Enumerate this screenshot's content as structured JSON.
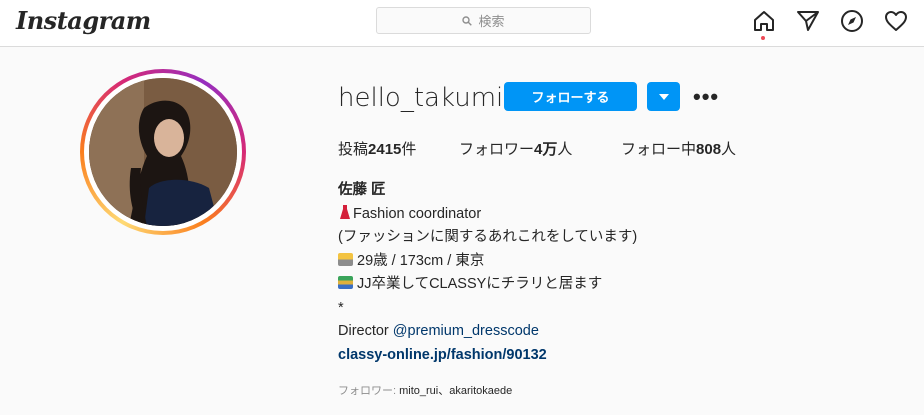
{
  "header": {
    "logo": "Instagram",
    "search_placeholder": "検索",
    "icons": [
      "home-icon",
      "direct-icon",
      "explore-icon",
      "activity-icon"
    ]
  },
  "profile": {
    "username": "hello_takumi",
    "follow_label": "フォローする",
    "stats": {
      "posts_label": "投稿",
      "posts_value": "2415",
      "posts_unit": "件",
      "followers_label": "フォロワー",
      "followers_value": "4万",
      "followers_unit": "人",
      "following_label": "フォロー中",
      "following_value": "808",
      "following_unit": "人"
    },
    "bio": {
      "name": "佐藤 匠",
      "line1": "Fashion coordinator",
      "line2": "(ファッションに関するあれこれをしています)",
      "line3": "29歳 / 173cm / 東京",
      "line4": "JJ卒業してCLASSYにチラリと居ます",
      "line5": "*",
      "director_label": "Director ",
      "director_link": "@premium_dresscode",
      "website": "classy-online.jp/fashion/90132"
    },
    "followed_by_label": "フォロワー: ",
    "followed_by_names": "mito_rui、akaritokaede"
  },
  "colors": {
    "accent": "#0095f6",
    "link": "#00376b",
    "notification": "#ed4956"
  }
}
